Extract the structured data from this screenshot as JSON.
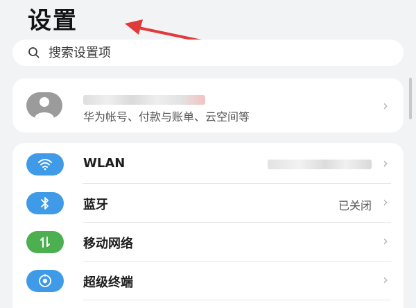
{
  "page": {
    "title": "设置"
  },
  "search": {
    "placeholder": "搜索设置项"
  },
  "account": {
    "subtitle": "华为帐号、付款与账单、云空间等"
  },
  "settings": [
    {
      "label": "WLAN",
      "value": "",
      "icon": "wifi-icon",
      "icon_color": "#3f9be8"
    },
    {
      "label": "蓝牙",
      "value": "已关闭",
      "icon": "bluetooth-icon",
      "icon_color": "#3f9be8"
    },
    {
      "label": "移动网络",
      "value": "",
      "icon": "mobile-data-icon",
      "icon_color": "#4caf50"
    },
    {
      "label": "超级终端",
      "value": "",
      "icon": "super-device-icon",
      "icon_color": "#3f9be8"
    }
  ],
  "colors": {
    "annotation_arrow": "#e03a3a",
    "background": "#f1f3f5"
  }
}
